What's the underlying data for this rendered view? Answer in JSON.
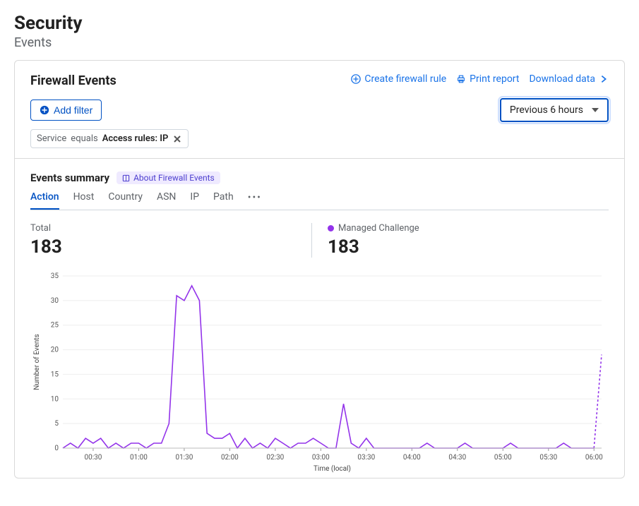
{
  "page": {
    "title": "Security",
    "subtitle": "Events"
  },
  "panel": {
    "title": "Firewall Events",
    "actions": {
      "create_rule": "Create firewall rule",
      "print_report": "Print report",
      "download_data": "Download data"
    },
    "add_filter_label": "Add filter",
    "time_range": "Previous 6 hours",
    "filter_chip": {
      "field": "Service",
      "operator": "equals",
      "value": "Access rules: IP"
    }
  },
  "summary": {
    "title": "Events summary",
    "about_label": "About Firewall Events"
  },
  "tabs": [
    "Action",
    "Host",
    "Country",
    "ASN",
    "IP",
    "Path"
  ],
  "active_tab": "Action",
  "stats": {
    "total_label": "Total",
    "total_value": "183",
    "series_label": "Managed Challenge",
    "series_value": "183",
    "series_color": "#9333ea"
  },
  "chart_data": {
    "type": "line",
    "title": "",
    "xlabel": "Time (local)",
    "ylabel": "Number of Events",
    "ylim": [
      0,
      35
    ],
    "yticks": [
      0,
      5,
      10,
      15,
      20,
      25,
      30,
      35
    ],
    "xticks": [
      "00:30",
      "01:00",
      "01:30",
      "02:00",
      "02:30",
      "03:00",
      "03:30",
      "04:00",
      "04:30",
      "05:00",
      "05:30",
      "06:00"
    ],
    "categories": [
      "00:10",
      "00:15",
      "00:20",
      "00:25",
      "00:30",
      "00:35",
      "00:40",
      "00:45",
      "00:50",
      "00:55",
      "01:00",
      "01:05",
      "01:10",
      "01:15",
      "01:20",
      "01:25",
      "01:30",
      "01:35",
      "01:40",
      "01:45",
      "01:50",
      "01:55",
      "02:00",
      "02:05",
      "02:10",
      "02:15",
      "02:20",
      "02:25",
      "02:30",
      "02:35",
      "02:40",
      "02:45",
      "02:50",
      "02:55",
      "03:00",
      "03:05",
      "03:10",
      "03:15",
      "03:20",
      "03:25",
      "03:30",
      "03:35",
      "03:40",
      "03:45",
      "03:50",
      "03:55",
      "04:00",
      "04:05",
      "04:10",
      "04:15",
      "04:20",
      "04:25",
      "04:30",
      "04:35",
      "04:40",
      "04:45",
      "04:50",
      "04:55",
      "05:00",
      "05:05",
      "05:10",
      "05:15",
      "05:20",
      "05:25",
      "05:30",
      "05:35",
      "05:40",
      "05:45",
      "05:50",
      "05:55",
      "06:00",
      "06:05"
    ],
    "series": [
      {
        "name": "Managed Challenge",
        "color": "#9333ea",
        "values": [
          0,
          1,
          0,
          2,
          1,
          2,
          0,
          1,
          0,
          1,
          1,
          0,
          1,
          1,
          5,
          31,
          30,
          33,
          30,
          3,
          2,
          2,
          3,
          0,
          2,
          0,
          1,
          0,
          2,
          1,
          0,
          1,
          1,
          2,
          1,
          0,
          0,
          9,
          1,
          0,
          2,
          0,
          0,
          0,
          0,
          0,
          0,
          0,
          1,
          0,
          0,
          0,
          0,
          1,
          0,
          0,
          0,
          0,
          0,
          1,
          0,
          0,
          0,
          0,
          0,
          0,
          1,
          0,
          0,
          0,
          0,
          19
        ],
        "dashed_from_index": 70
      }
    ]
  }
}
